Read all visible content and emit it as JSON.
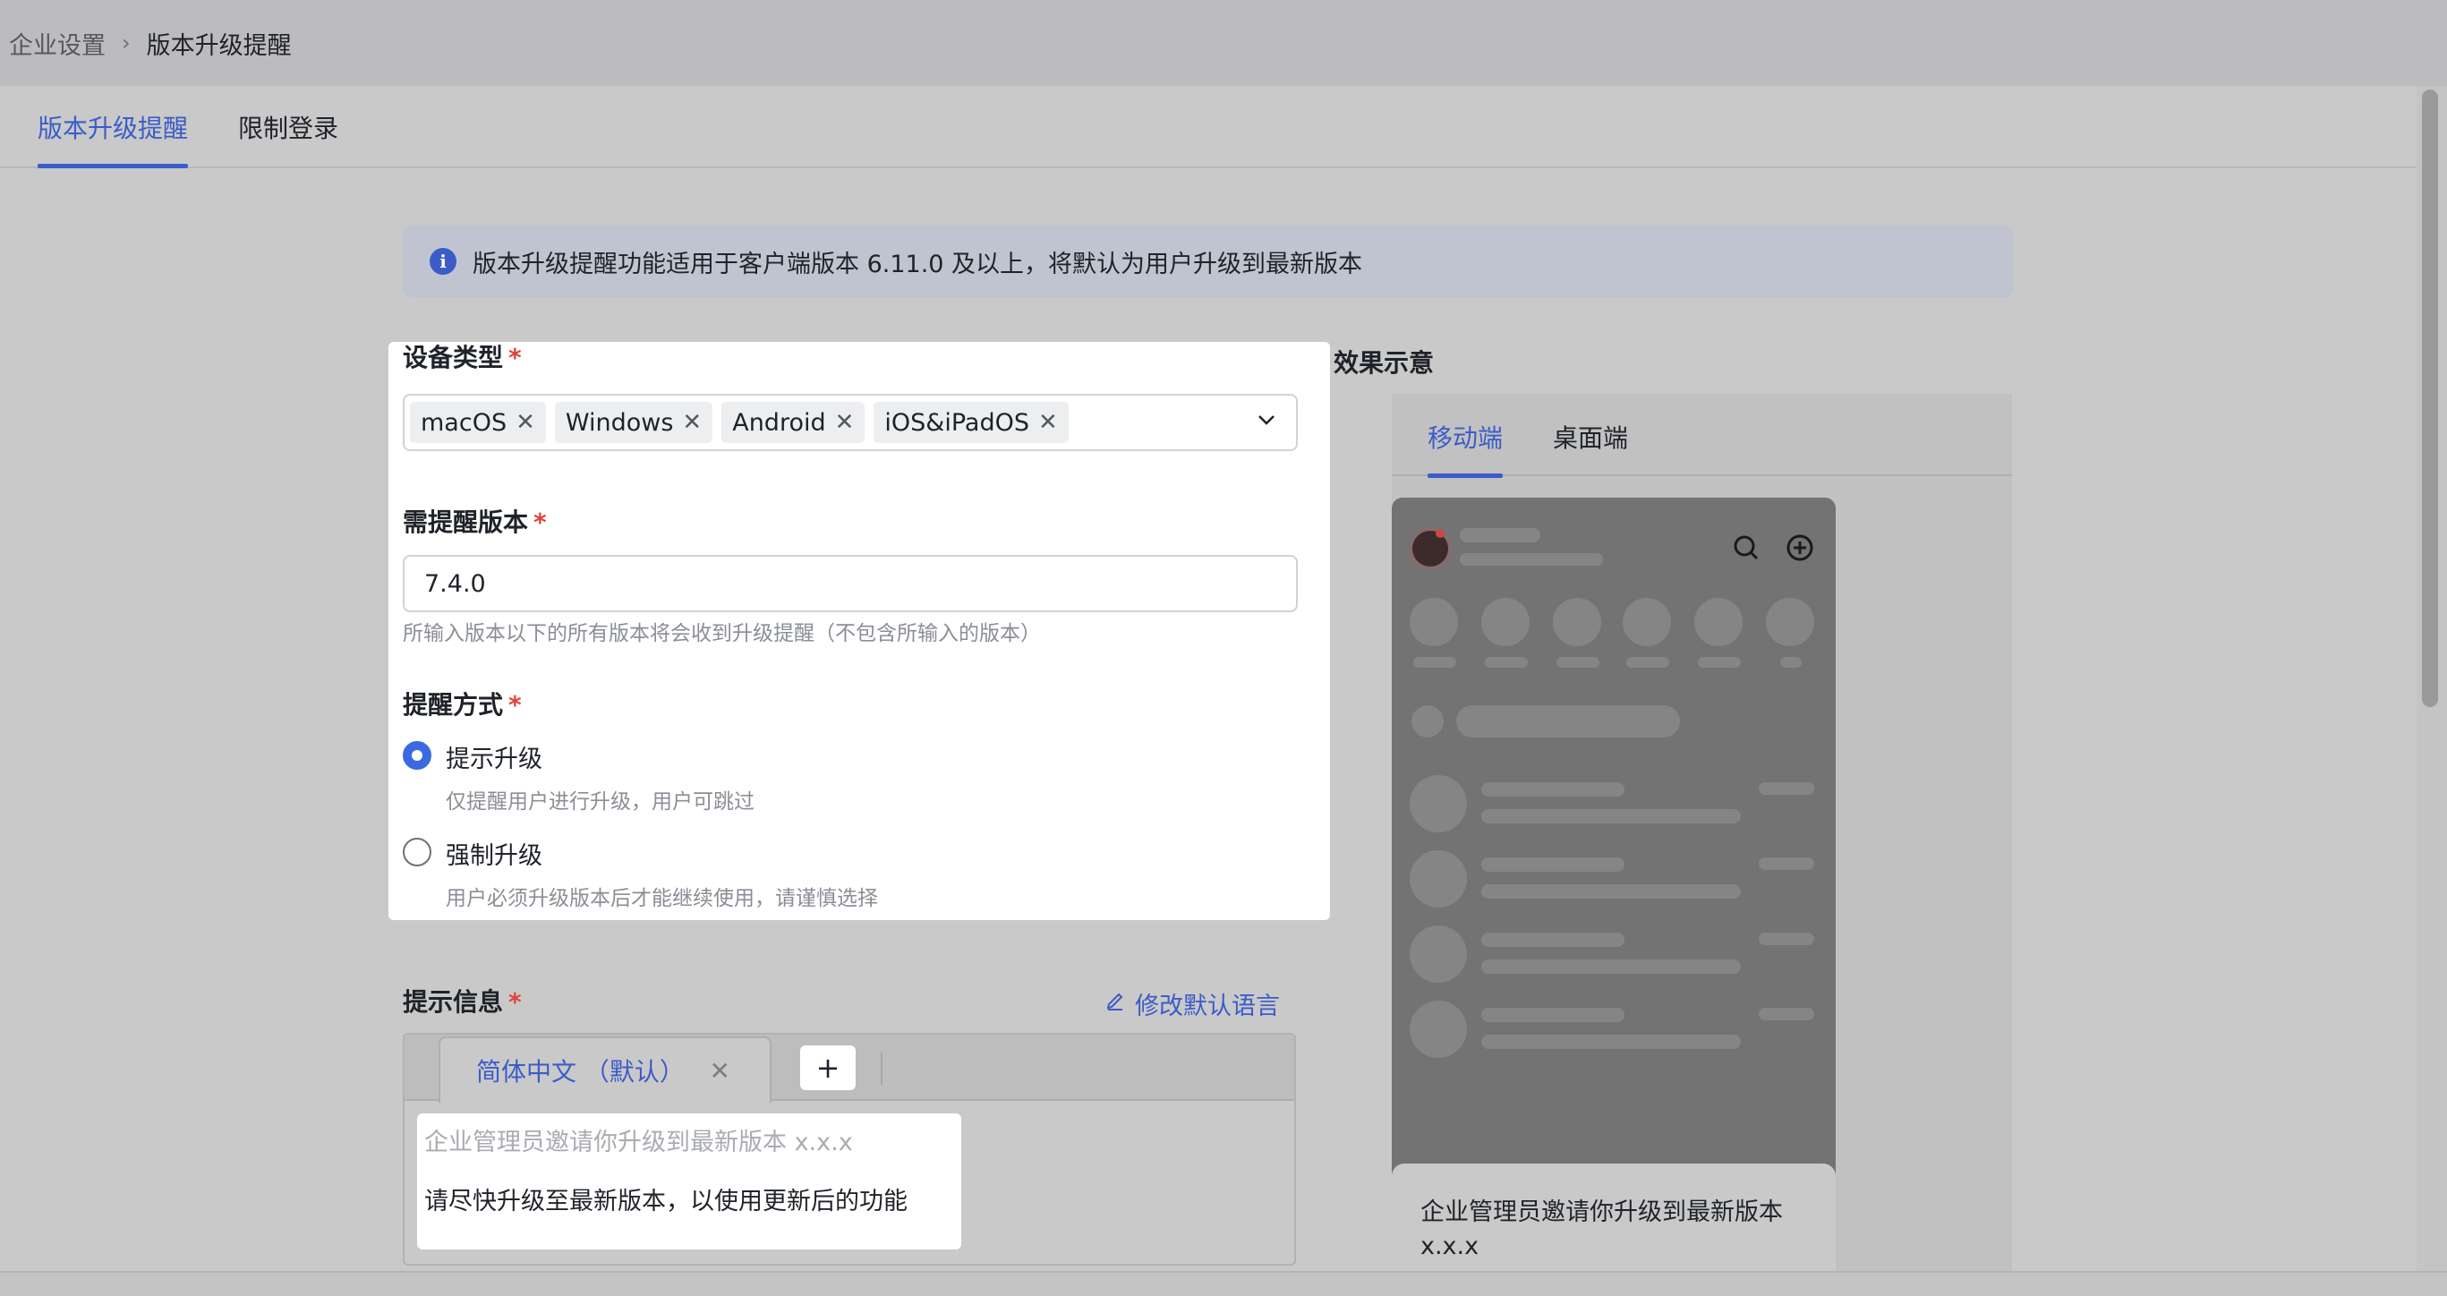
{
  "breadcrumb": {
    "parent": "企业设置",
    "separator": "›",
    "current": "版本升级提醒"
  },
  "tabs": [
    {
      "label": "版本升级提醒"
    },
    {
      "label": "限制登录"
    }
  ],
  "notice": {
    "text": "版本升级提醒功能适用于客户端版本 6.11.0 及以上，将默认为用户升级到最新版本",
    "icon": "info-icon"
  },
  "form": {
    "device_type": {
      "label": "设备类型",
      "required": "*",
      "chips": [
        "macOS",
        "Windows",
        "Android",
        "iOS&iPadOS"
      ],
      "remove_glyph": "✕"
    },
    "version": {
      "label": "需提醒版本",
      "required": "*",
      "value": "7.4.0",
      "hint": "所输入版本以下的所有版本将会收到升级提醒（不包含所输入的版本）"
    },
    "method": {
      "label": "提醒方式",
      "required": "*",
      "options": [
        {
          "label": "提示升级",
          "desc": "仅提醒用户进行升级，用户可跳过",
          "selected": true
        },
        {
          "label": "强制升级",
          "desc": "用户必须升级版本后才能继续使用，请谨慎选择",
          "selected": false
        }
      ]
    },
    "message": {
      "label": "提示信息",
      "required": "*",
      "edit_lang": "修改默认语言",
      "lang_tab": "简体中文 （默认）",
      "close_glyph": "✕",
      "add_glyph": "+",
      "title_placeholder": "企业管理员邀请你升级到最新版本 x.x.x",
      "body": "请尽快升级至最新版本，以使用更新后的功能"
    }
  },
  "preview": {
    "label": "效果示意",
    "tabs": [
      {
        "label": "移动端"
      },
      {
        "label": "桌面端"
      }
    ],
    "sheet_text": "企业管理员邀请你升级到最新版本 x.x.x"
  },
  "colors": {
    "accent": "#3b5cc8",
    "required": "#e0433a",
    "overlay": "#c9c9c9"
  }
}
